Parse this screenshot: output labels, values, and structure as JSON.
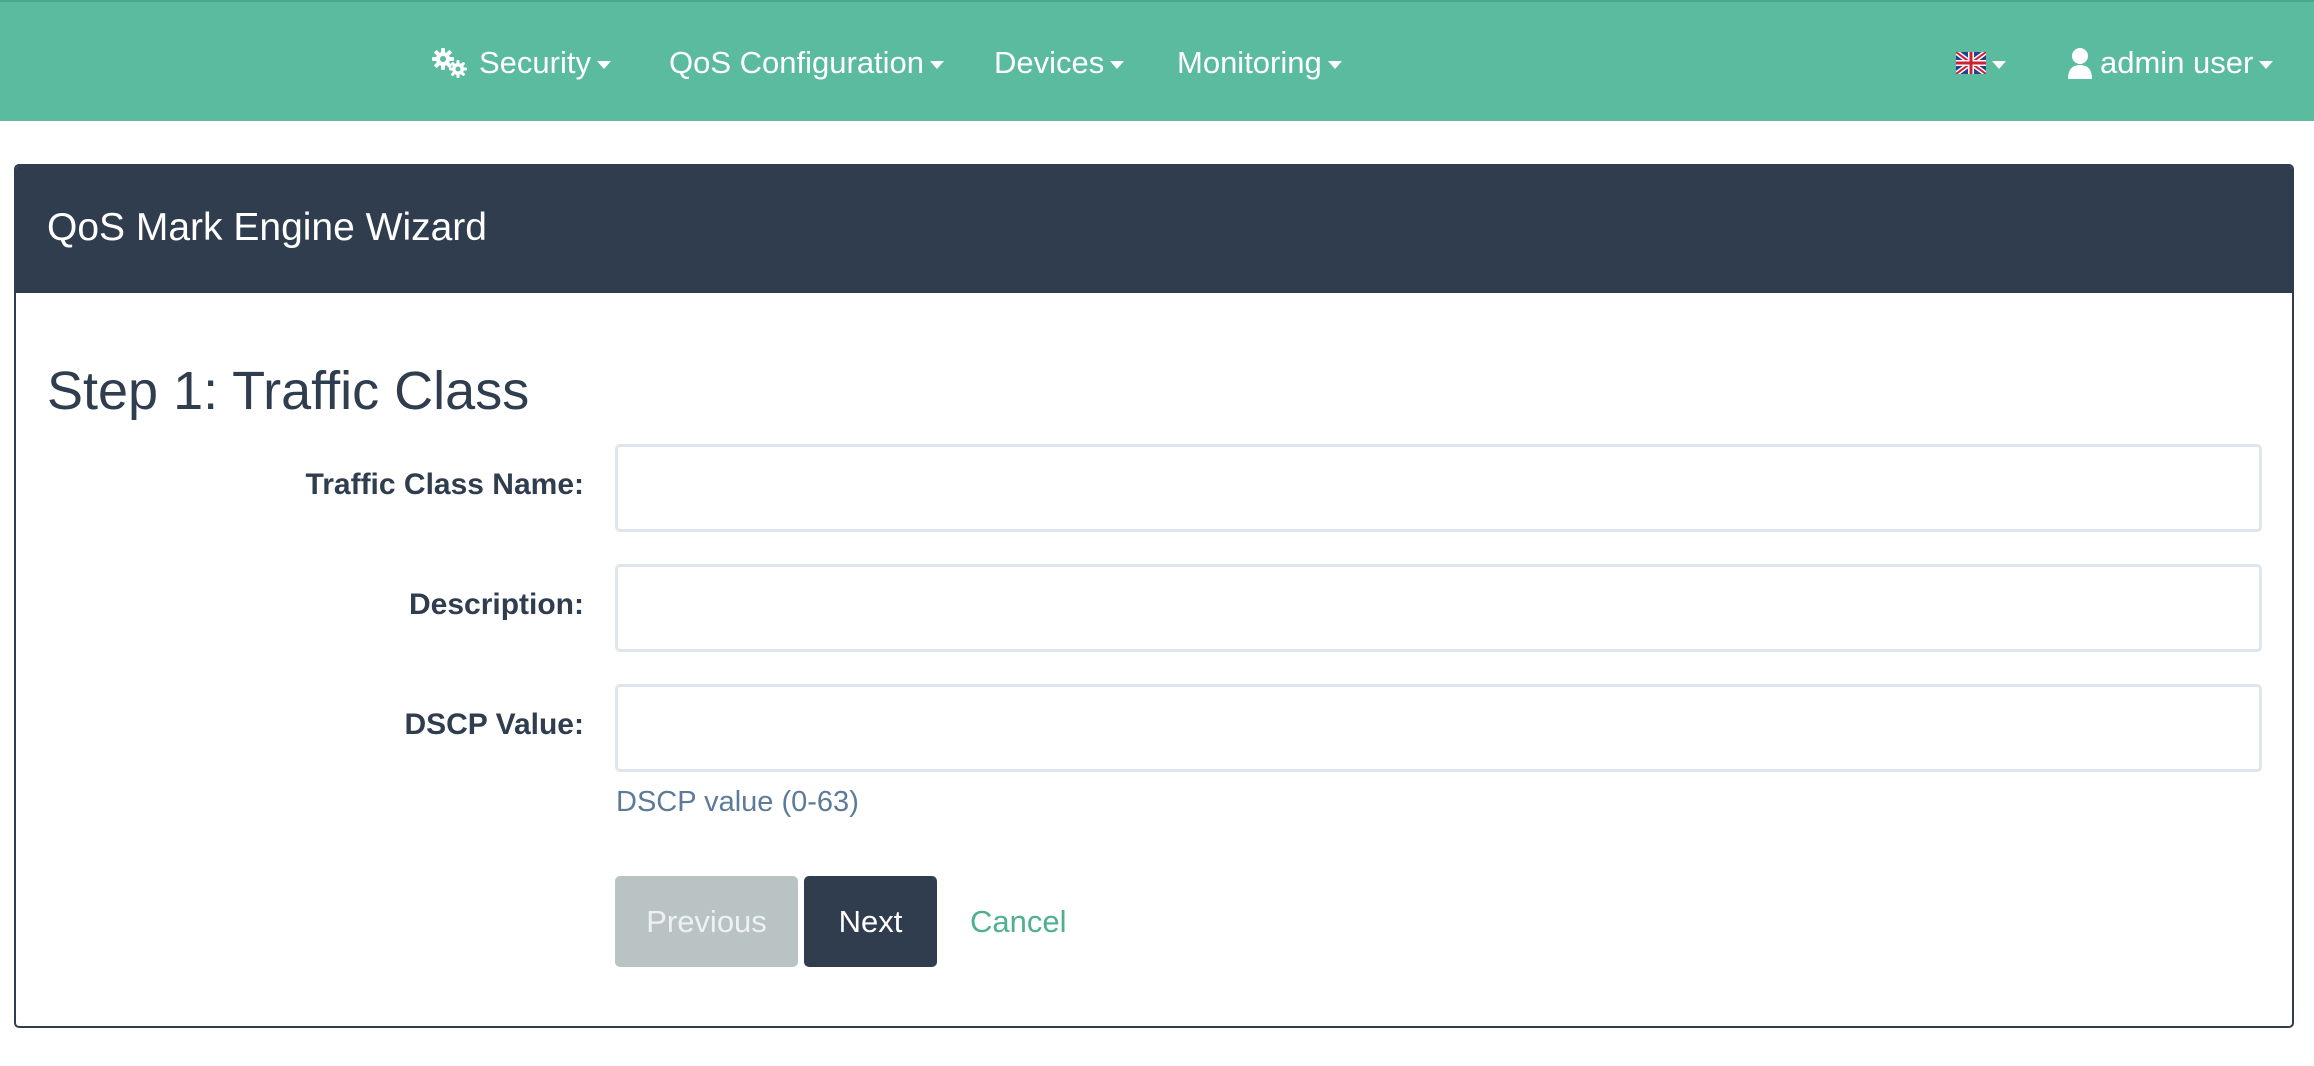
{
  "nav": {
    "items": [
      {
        "label": "Security",
        "icon": "gears-icon"
      },
      {
        "label": "QoS Configuration"
      },
      {
        "label": "Devices"
      },
      {
        "label": "Monitoring"
      }
    ],
    "language_icon": "uk-flag-icon",
    "user": {
      "label": "admin user",
      "icon": "user-icon"
    }
  },
  "colors": {
    "navbar": "#5abb9e",
    "panel_header": "#2f3d4f",
    "accent_link": "#4fb08f",
    "disabled_button": "#bac3c4"
  },
  "wizard": {
    "title": "QoS Mark Engine Wizard",
    "step_title": "Step 1: Traffic Class",
    "fields": [
      {
        "label": "Traffic Class Name:",
        "value": "",
        "placeholder": ""
      },
      {
        "label": "Description:",
        "value": "",
        "placeholder": ""
      },
      {
        "label": "DSCP Value:",
        "value": "",
        "placeholder": ""
      }
    ],
    "dscp_help": "DSCP value (0-63)",
    "buttons": {
      "previous": "Previous",
      "next": "Next",
      "cancel": "Cancel"
    }
  }
}
